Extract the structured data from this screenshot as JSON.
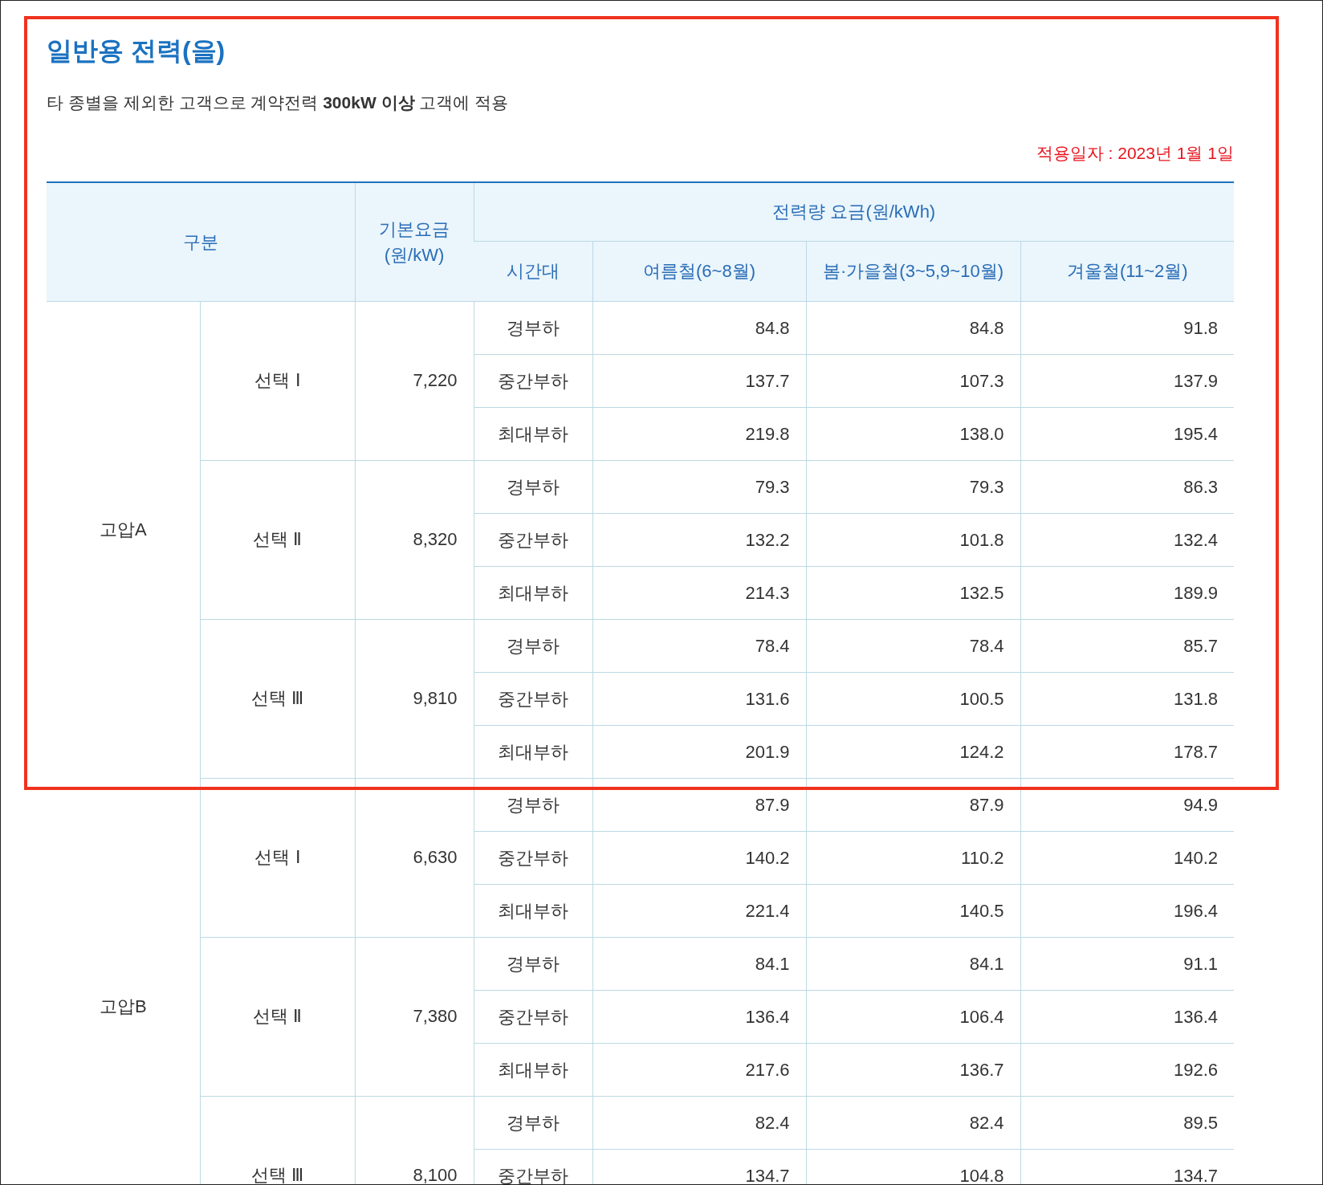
{
  "title": "일반용 전력(을)",
  "description": "타 종별을 제외한 고객으로 계약전력 **300kW 이상** 고객에 적용",
  "effective_date": "적용일자 : 2023년 1월 1일",
  "table": {
    "columns": {
      "category": "구분",
      "base_rate": [
        "기본요금",
        "(원/kW)"
      ],
      "energy_rate": "전력량 요금(원/kWh)",
      "time_band": "시간대",
      "seasons": [
        "여름철(6~8월)",
        "봄·가을철(3~5,9~10월)",
        "겨울철(11~2월)"
      ]
    },
    "groups": [
      {
        "name": "고압A",
        "options": [
          {
            "name": "선택 Ⅰ",
            "base_rate": "7,220",
            "rows": [
              {
                "time_band": "경부하",
                "values": [
                  "84.8",
                  "84.8",
                  "91.8"
                ]
              },
              {
                "time_band": "중간부하",
                "values": [
                  "137.7",
                  "107.3",
                  "137.9"
                ]
              },
              {
                "time_band": "최대부하",
                "values": [
                  "219.8",
                  "138.0",
                  "195.4"
                ]
              }
            ]
          },
          {
            "name": "선택 Ⅱ",
            "base_rate": "8,320",
            "rows": [
              {
                "time_band": "경부하",
                "values": [
                  "79.3",
                  "79.3",
                  "86.3"
                ]
              },
              {
                "time_band": "중간부하",
                "values": [
                  "132.2",
                  "101.8",
                  "132.4"
                ]
              },
              {
                "time_band": "최대부하",
                "values": [
                  "214.3",
                  "132.5",
                  "189.9"
                ]
              }
            ]
          },
          {
            "name": "선택 Ⅲ",
            "base_rate": "9,810",
            "rows": [
              {
                "time_band": "경부하",
                "values": [
                  "78.4",
                  "78.4",
                  "85.7"
                ]
              },
              {
                "time_band": "중간부하",
                "values": [
                  "131.6",
                  "100.5",
                  "131.8"
                ]
              },
              {
                "time_band": "최대부하",
                "values": [
                  "201.9",
                  "124.2",
                  "178.7"
                ]
              }
            ]
          }
        ]
      },
      {
        "name": "고압B",
        "options": [
          {
            "name": "선택 Ⅰ",
            "base_rate": "6,630",
            "rows": [
              {
                "time_band": "경부하",
                "values": [
                  "87.9",
                  "87.9",
                  "94.9"
                ]
              },
              {
                "time_band": "중간부하",
                "values": [
                  "140.2",
                  "110.2",
                  "140.2"
                ]
              },
              {
                "time_band": "최대부하",
                "values": [
                  "221.4",
                  "140.5",
                  "196.4"
                ]
              }
            ]
          },
          {
            "name": "선택 Ⅱ",
            "base_rate": "7,380",
            "rows": [
              {
                "time_band": "경부하",
                "values": [
                  "84.1",
                  "84.1",
                  "91.1"
                ]
              },
              {
                "time_band": "중간부하",
                "values": [
                  "136.4",
                  "106.4",
                  "136.4"
                ]
              },
              {
                "time_band": "최대부하",
                "values": [
                  "217.6",
                  "136.7",
                  "192.6"
                ]
              }
            ]
          },
          {
            "name": "선택 Ⅲ",
            "base_rate": "8,100",
            "rows": [
              {
                "time_band": "경부하",
                "values": [
                  "82.4",
                  "82.4",
                  "89.5"
                ]
              },
              {
                "time_band": "중간부하",
                "values": [
                  "134.7",
                  "104.8",
                  "134.7"
                ]
              }
            ]
          }
        ]
      }
    ]
  }
}
